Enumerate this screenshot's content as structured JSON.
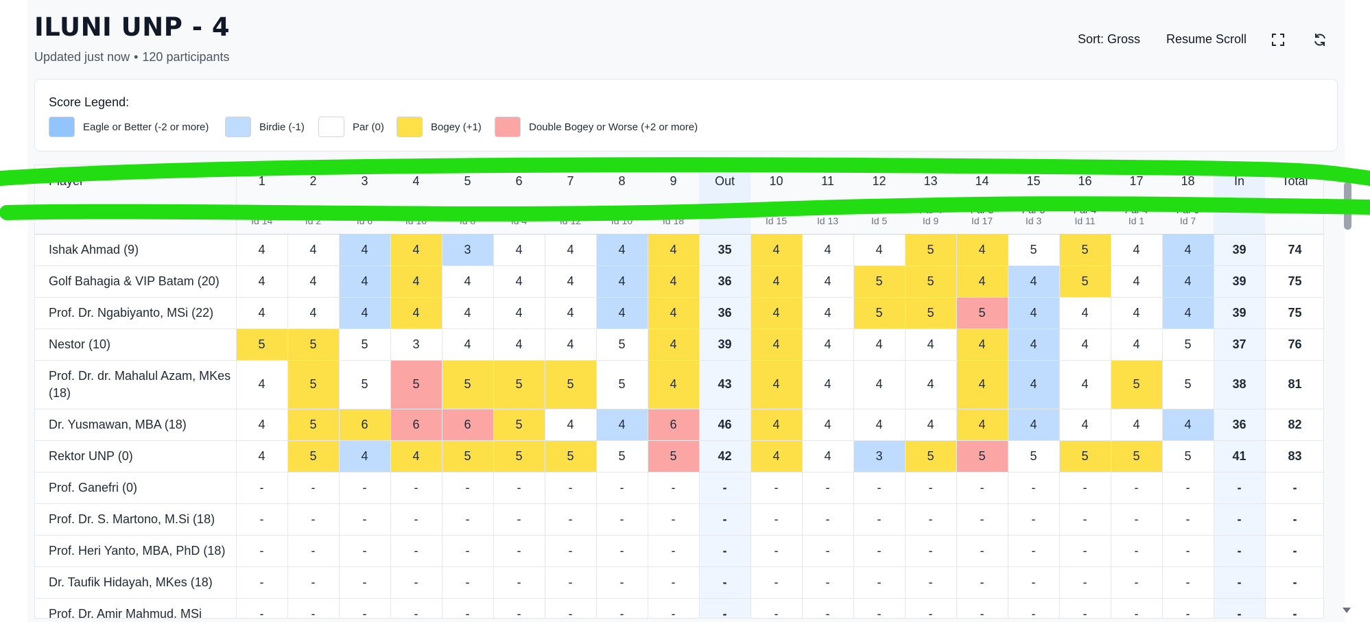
{
  "header": {
    "title": "ILUNI UNP - 4",
    "updated": "Updated just now",
    "separator": "•",
    "participants": "120 participants"
  },
  "toolbar": {
    "sort_label": "Sort: Gross",
    "resume_label": "Resume Scroll",
    "fullscreen_icon": "expand-icon",
    "refresh_icon": "refresh-icon"
  },
  "legend": {
    "title": "Score Legend:",
    "items": [
      {
        "label": "Eagle or Better (-2 or more)",
        "color": "#93c5fd"
      },
      {
        "label": "Birdie (-1)",
        "color": "#bfdbfe"
      },
      {
        "label": "Par (0)",
        "color": "#ffffff"
      },
      {
        "label": "Bogey (+1)",
        "color": "#fde047"
      },
      {
        "label": "Double Bogey or Worse (+2 or more)",
        "color": "#fca5a5"
      }
    ]
  },
  "table": {
    "columns": {
      "player": "Player",
      "out": "Out",
      "in": "In",
      "total": "Total"
    },
    "holes": [
      {
        "num": "1",
        "par": "Par 4",
        "idx": "Id 14"
      },
      {
        "num": "2",
        "par": "Par 4",
        "idx": "Id 2"
      },
      {
        "num": "3",
        "par": "Par 5",
        "idx": "Id 6"
      },
      {
        "num": "4",
        "par": "Par 3",
        "idx": "Id 16"
      },
      {
        "num": "5",
        "par": "Par 4",
        "idx": "Id 8"
      },
      {
        "num": "6",
        "par": "Par 4",
        "idx": "Id 4"
      },
      {
        "num": "7",
        "par": "Par 4",
        "idx": "Id 12"
      },
      {
        "num": "8",
        "par": "Par 5",
        "idx": "Id 10"
      },
      {
        "num": "9",
        "par": "Par 3",
        "idx": "Id 18"
      },
      {
        "num": "10",
        "par": "Par 3",
        "idx": "Id 15"
      },
      {
        "num": "11",
        "par": "Par 4",
        "idx": "Id 13"
      },
      {
        "num": "12",
        "par": "Par 4",
        "idx": "Id 5"
      },
      {
        "num": "13",
        "par": "Par 4",
        "idx": "Id 9"
      },
      {
        "num": "14",
        "par": "Par 3",
        "idx": "Id 17"
      },
      {
        "num": "15",
        "par": "Par 5",
        "idx": "Id 3"
      },
      {
        "num": "16",
        "par": "Par 4",
        "idx": "Id 11"
      },
      {
        "num": "17",
        "par": "Par 4",
        "idx": "Id 1"
      },
      {
        "num": "18",
        "par": "Par 5",
        "idx": "Id 7"
      }
    ],
    "rows": [
      {
        "name": "Ishak Ahmad (9)",
        "scores": [
          "4",
          "4",
          "4",
          "4",
          "3",
          "4",
          "4",
          "4",
          "4",
          "4",
          "4",
          "4",
          "5",
          "4",
          "5",
          "5",
          "4",
          "4"
        ],
        "classes": [
          "par",
          "par",
          "birdie",
          "bogey",
          "birdie",
          "par",
          "par",
          "birdie",
          "bogey",
          "bogey",
          "par",
          "par",
          "bogey",
          "bogey",
          "par",
          "bogey",
          "par",
          "birdie"
        ],
        "out": "35",
        "in": "39",
        "total": "74"
      },
      {
        "name": "Golf Bahagia & VIP Batam (20)",
        "scores": [
          "4",
          "4",
          "4",
          "4",
          "4",
          "4",
          "4",
          "4",
          "4",
          "4",
          "4",
          "5",
          "5",
          "4",
          "4",
          "5",
          "4",
          "4"
        ],
        "classes": [
          "par",
          "par",
          "birdie",
          "bogey",
          "par",
          "par",
          "par",
          "birdie",
          "bogey",
          "bogey",
          "par",
          "bogey",
          "bogey",
          "bogey",
          "birdie",
          "bogey",
          "par",
          "birdie"
        ],
        "out": "36",
        "in": "39",
        "total": "75"
      },
      {
        "name": "Prof. Dr. Ngabiyanto, MSi (22)",
        "scores": [
          "4",
          "4",
          "4",
          "4",
          "4",
          "4",
          "4",
          "4",
          "4",
          "4",
          "4",
          "5",
          "5",
          "5",
          "4",
          "4",
          "4",
          "4"
        ],
        "classes": [
          "par",
          "par",
          "birdie",
          "bogey",
          "par",
          "par",
          "par",
          "birdie",
          "bogey",
          "bogey",
          "par",
          "bogey",
          "bogey",
          "double",
          "birdie",
          "par",
          "par",
          "birdie"
        ],
        "out": "36",
        "in": "39",
        "total": "75"
      },
      {
        "name": "Nestor (10)",
        "scores": [
          "5",
          "5",
          "5",
          "3",
          "4",
          "4",
          "4",
          "5",
          "4",
          "4",
          "4",
          "4",
          "4",
          "4",
          "4",
          "4",
          "4",
          "5"
        ],
        "classes": [
          "bogey",
          "bogey",
          "par",
          "par",
          "par",
          "par",
          "par",
          "par",
          "bogey",
          "bogey",
          "par",
          "par",
          "par",
          "bogey",
          "birdie",
          "par",
          "par",
          "par"
        ],
        "out": "39",
        "in": "37",
        "total": "76"
      },
      {
        "name": "Prof. Dr. dr. Mahalul Azam, MKes (18)",
        "tall": true,
        "scores": [
          "4",
          "5",
          "5",
          "5",
          "5",
          "5",
          "5",
          "5",
          "4",
          "4",
          "4",
          "4",
          "4",
          "4",
          "4",
          "4",
          "5",
          "5"
        ],
        "classes": [
          "par",
          "bogey",
          "par",
          "double",
          "bogey",
          "bogey",
          "bogey",
          "par",
          "bogey",
          "bogey",
          "par",
          "par",
          "par",
          "bogey",
          "birdie",
          "par",
          "bogey",
          "par"
        ],
        "out": "43",
        "in": "38",
        "total": "81"
      },
      {
        "name": "Dr. Yusmawan, MBA (18)",
        "scores": [
          "4",
          "5",
          "6",
          "6",
          "6",
          "5",
          "4",
          "4",
          "6",
          "4",
          "4",
          "4",
          "4",
          "4",
          "4",
          "4",
          "4",
          "4"
        ],
        "classes": [
          "par",
          "bogey",
          "bogey",
          "double",
          "double",
          "bogey",
          "par",
          "birdie",
          "double",
          "bogey",
          "par",
          "par",
          "par",
          "bogey",
          "birdie",
          "par",
          "par",
          "birdie"
        ],
        "out": "46",
        "in": "36",
        "total": "82"
      },
      {
        "name": "Rektor UNP (0)",
        "scores": [
          "4",
          "5",
          "4",
          "4",
          "5",
          "5",
          "5",
          "5",
          "5",
          "4",
          "4",
          "3",
          "5",
          "5",
          "5",
          "5",
          "5",
          "5"
        ],
        "classes": [
          "par",
          "bogey",
          "birdie",
          "bogey",
          "bogey",
          "bogey",
          "bogey",
          "par",
          "double",
          "bogey",
          "par",
          "birdie",
          "bogey",
          "double",
          "par",
          "bogey",
          "bogey",
          "par"
        ],
        "out": "42",
        "in": "41",
        "total": "83"
      },
      {
        "name": "Prof. Ganefri (0)",
        "empty": true
      },
      {
        "name": "Prof. Dr. S. Martono, M.Si (18)",
        "empty": true
      },
      {
        "name": "Prof. Heri Yanto, MBA, PhD (18)",
        "empty": true
      },
      {
        "name": "Dr. Taufik Hidayah, MKes (18)",
        "empty": true
      },
      {
        "name": "Prof. Dr. Amir Mahmud, MSi",
        "empty": true
      }
    ],
    "empty_mark": "-"
  }
}
